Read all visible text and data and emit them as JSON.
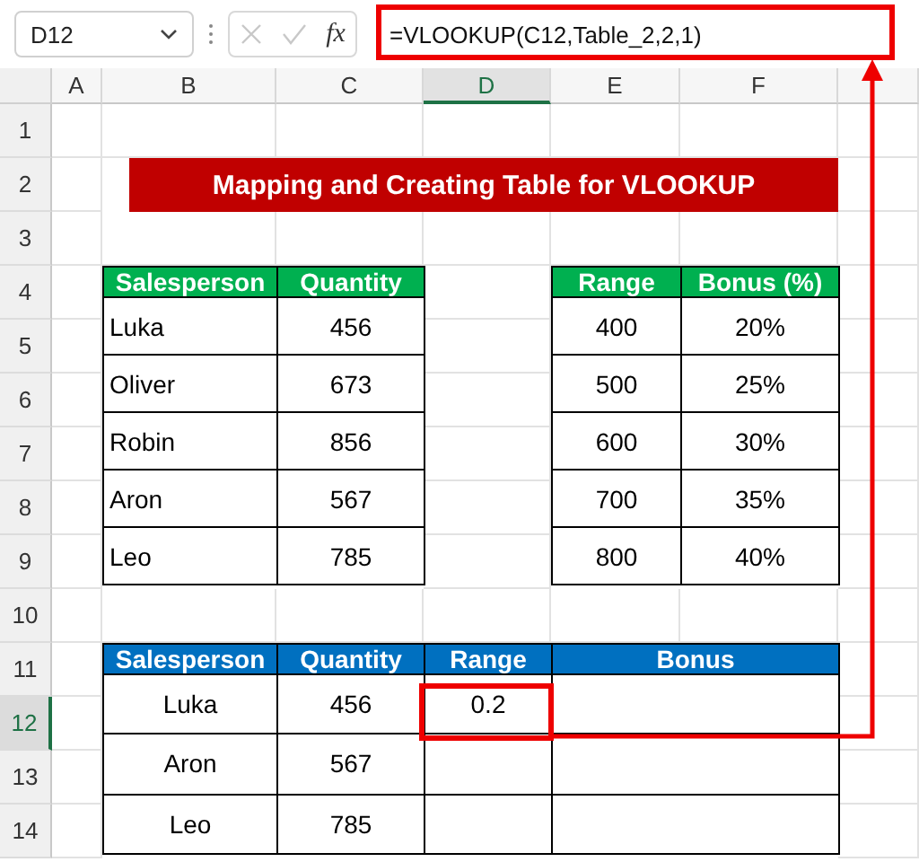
{
  "name_box": "D12",
  "function_label": "fx",
  "formula": "=VLOOKUP(C12,Table_2,2,1)",
  "columns": [
    {
      "label": "A",
      "selected": false
    },
    {
      "label": "B",
      "selected": false
    },
    {
      "label": "C",
      "selected": false
    },
    {
      "label": "D",
      "selected": true
    },
    {
      "label": "E",
      "selected": false
    },
    {
      "label": "F",
      "selected": false
    }
  ],
  "rows": [
    {
      "label": "1",
      "selected": false
    },
    {
      "label": "2",
      "selected": false
    },
    {
      "label": "3",
      "selected": false
    },
    {
      "label": "4",
      "selected": false
    },
    {
      "label": "5",
      "selected": false
    },
    {
      "label": "6",
      "selected": false
    },
    {
      "label": "7",
      "selected": false
    },
    {
      "label": "8",
      "selected": false
    },
    {
      "label": "9",
      "selected": false
    },
    {
      "label": "10",
      "selected": false
    },
    {
      "label": "11",
      "selected": false
    },
    {
      "label": "12",
      "selected": true
    },
    {
      "label": "13",
      "selected": false
    },
    {
      "label": "14",
      "selected": false
    }
  ],
  "title": "Mapping and Creating Table for VLOOKUP",
  "sales_table": {
    "columns": [
      "Salesperson",
      "Quantity"
    ],
    "rows": [
      [
        "Luka",
        "456"
      ],
      [
        "Oliver",
        "673"
      ],
      [
        "Robin",
        "856"
      ],
      [
        "Aron",
        "567"
      ],
      [
        "Leo",
        "785"
      ]
    ]
  },
  "bonus_table": {
    "columns": [
      "Range",
      "Bonus (%)"
    ],
    "rows": [
      [
        "400",
        "20%"
      ],
      [
        "500",
        "25%"
      ],
      [
        "600",
        "30%"
      ],
      [
        "700",
        "35%"
      ],
      [
        "800",
        "40%"
      ]
    ]
  },
  "result_table": {
    "columns": [
      "Salesperson",
      "Quantity",
      "Range",
      "Bonus"
    ],
    "rows": [
      [
        "Luka",
        "456",
        "0.2"
      ],
      [
        "Aron",
        "567"
      ],
      [
        "Leo",
        "785"
      ]
    ]
  }
}
